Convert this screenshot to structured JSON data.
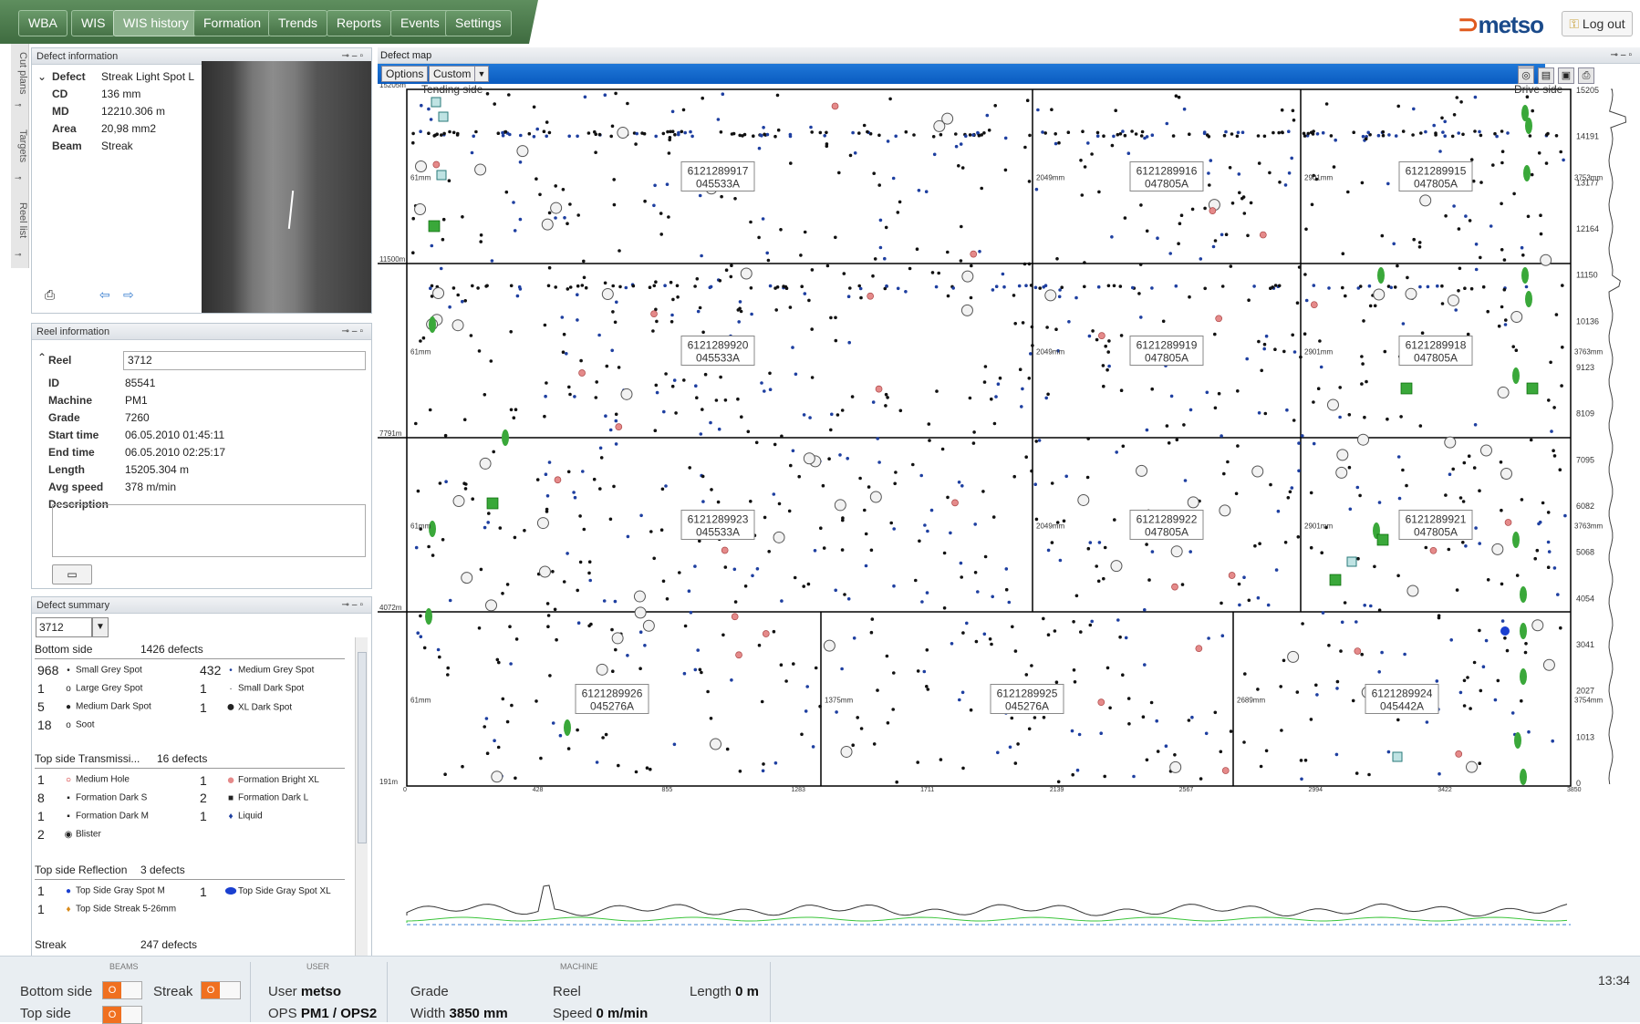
{
  "nav": [
    "WBA",
    "WIS",
    "WIS history",
    "Formation",
    "Trends",
    "Reports",
    "Events",
    "Settings"
  ],
  "nav_selected": "WIS history",
  "brand": "metso",
  "logout": "Log out",
  "side_tabs": [
    "Cut plans",
    "Targets",
    "Reel list"
  ],
  "defect_info": {
    "title": "Defect information",
    "rows": [
      [
        "Defect",
        "Streak Light Spot L"
      ],
      [
        "CD",
        "136 mm"
      ],
      [
        "MD",
        "12210.306 m"
      ],
      [
        "Area",
        "20,98 mm2"
      ],
      [
        "Beam",
        "Streak"
      ]
    ],
    "icons": [
      "printer-icon",
      "arrow-left-icon",
      "arrow-right-icon"
    ]
  },
  "reel_info": {
    "title": "Reel information",
    "reel_label": "Reel",
    "reel_value": "3712",
    "rows": [
      [
        "ID",
        "85541"
      ],
      [
        "Machine",
        "PM1"
      ],
      [
        "Grade",
        "7260"
      ],
      [
        "Start time",
        "06.05.2010 01:45:11"
      ],
      [
        "End time",
        "06.05.2010 02:25:17"
      ],
      [
        "Length",
        "15205.304 m"
      ],
      [
        "Avg speed",
        "378 m/min"
      ],
      [
        "Description",
        ""
      ]
    ]
  },
  "defect_summary": {
    "title": "Defect summary",
    "selected": "3712",
    "sections": [
      {
        "title": "Bottom side",
        "count": "1426 defects",
        "items": [
          [
            "968",
            "Small Grey Spot"
          ],
          [
            "432",
            "Medium Grey Spot"
          ],
          [
            "1",
            "Large Grey Spot"
          ],
          [
            "1",
            "Small Dark Spot"
          ],
          [
            "5",
            "Medium Dark Spot"
          ],
          [
            "1",
            "XL Dark Spot"
          ],
          [
            "18",
            "Soot"
          ]
        ]
      },
      {
        "title": "Top side Transmissi...",
        "count": "16 defects",
        "items": [
          [
            "1",
            "Medium Hole"
          ],
          [
            "1",
            "Formation Bright XL"
          ],
          [
            "8",
            "Formation Dark  S"
          ],
          [
            "2",
            "Formation Dark L"
          ],
          [
            "1",
            "Formation Dark M"
          ],
          [
            "1",
            "Liquid"
          ],
          [
            "2",
            "Blister"
          ]
        ]
      },
      {
        "title": "Top side Reflection",
        "count": "3 defects",
        "items": [
          [
            "1",
            "Top Side Gray Spot M"
          ],
          [
            "1",
            "Top Side Gray Spot XL"
          ],
          [
            "1",
            "Top Side Streak 5-26mm"
          ]
        ]
      },
      {
        "title": "Streak",
        "count": "247 defects",
        "items": []
      }
    ]
  },
  "map": {
    "title": "Defect map",
    "options": "Options",
    "preset": "Custom",
    "tending": "Tending side",
    "drive": "Drive side",
    "y_left": [
      "15205m",
      "11500m",
      "7791m",
      "4072m",
      "191m"
    ],
    "y_right": [
      "15205",
      "14191",
      "13177",
      "12164",
      "11150",
      "10136",
      "9123",
      "8109",
      "7095",
      "6082",
      "5068",
      "4054",
      "3041",
      "2027",
      "1013",
      "0"
    ],
    "x_ticks": [
      "0",
      "428",
      "855",
      "1283",
      "1711",
      "2139",
      "2567",
      "2994",
      "3422",
      "3850"
    ],
    "right_mm": [
      "3753mm",
      "3763mm",
      "3763mm",
      "3754mm"
    ],
    "rows": [
      {
        "cells": [
          {
            "id": "6121289917",
            "code": "045533A",
            "mm": "61mm"
          },
          {
            "id": "6121289916",
            "code": "047805A",
            "mm": "2049mm"
          },
          {
            "id": "6121289915",
            "code": "047805A",
            "mm": "2901mm"
          }
        ]
      },
      {
        "cells": [
          {
            "id": "6121289920",
            "code": "045533A",
            "mm": "61mm"
          },
          {
            "id": "6121289919",
            "code": "047805A",
            "mm": "2049mm"
          },
          {
            "id": "6121289918",
            "code": "047805A",
            "mm": "2901mm"
          }
        ]
      },
      {
        "cells": [
          {
            "id": "6121289923",
            "code": "045533A",
            "mm": "61mm"
          },
          {
            "id": "6121289922",
            "code": "047805A",
            "mm": "2049mm"
          },
          {
            "id": "6121289921",
            "code": "047805A",
            "mm": "2901mm"
          }
        ]
      },
      {
        "cells": [
          {
            "id": "6121289926",
            "code": "045276A",
            "mm": "61mm"
          },
          {
            "id": "6121289925",
            "code": "045276A",
            "mm": "1375mm"
          },
          {
            "id": "6121289924",
            "code": "045442A",
            "mm": "2689mm"
          }
        ]
      }
    ]
  },
  "status": {
    "beams_title": "BEAMS",
    "bottom_side": "Bottom side",
    "streak": "Streak",
    "top_side": "Top side",
    "user_title": "USER",
    "user_label": "User",
    "user": "metso",
    "ops_label": "OPS",
    "ops": "PM1 / OPS2",
    "machine_title": "MACHINE",
    "grade_label": "Grade",
    "width_label": "Width",
    "width": "3850 mm",
    "reel_label": "Reel",
    "speed_label": "Speed",
    "speed": "0 m/min",
    "length_label": "Length",
    "length": "0 m",
    "clock": "13:34"
  },
  "colors": {
    "accent": "#1f78d8",
    "nav_green": "#4f7f4f",
    "blue_dot": "#1e3fa0",
    "green_defect": "#3aa83a",
    "pink_defect": "#e58a8a"
  }
}
